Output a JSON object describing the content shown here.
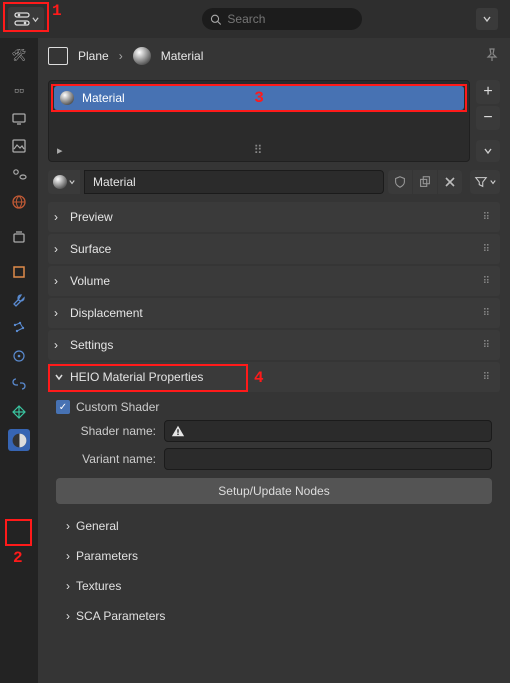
{
  "search": {
    "placeholder": "Search"
  },
  "breadcrumb": {
    "object": "Plane",
    "material": "Material"
  },
  "slots": {
    "active": "Material"
  },
  "material": {
    "name": "Material"
  },
  "panels": {
    "preview": "Preview",
    "surface": "Surface",
    "volume": "Volume",
    "displacement": "Displacement",
    "settings": "Settings",
    "heio": "HEIO Material Properties"
  },
  "heio": {
    "custom_shader_label": "Custom Shader",
    "shader_name_label": "Shader name:",
    "variant_name_label": "Variant name:",
    "setup_btn": "Setup/Update Nodes",
    "sub": {
      "general": "General",
      "parameters": "Parameters",
      "textures": "Textures",
      "sca": "SCA Parameters"
    }
  },
  "annotations": {
    "a1": "1",
    "a2": "2",
    "a3": "3",
    "a4": "4"
  }
}
